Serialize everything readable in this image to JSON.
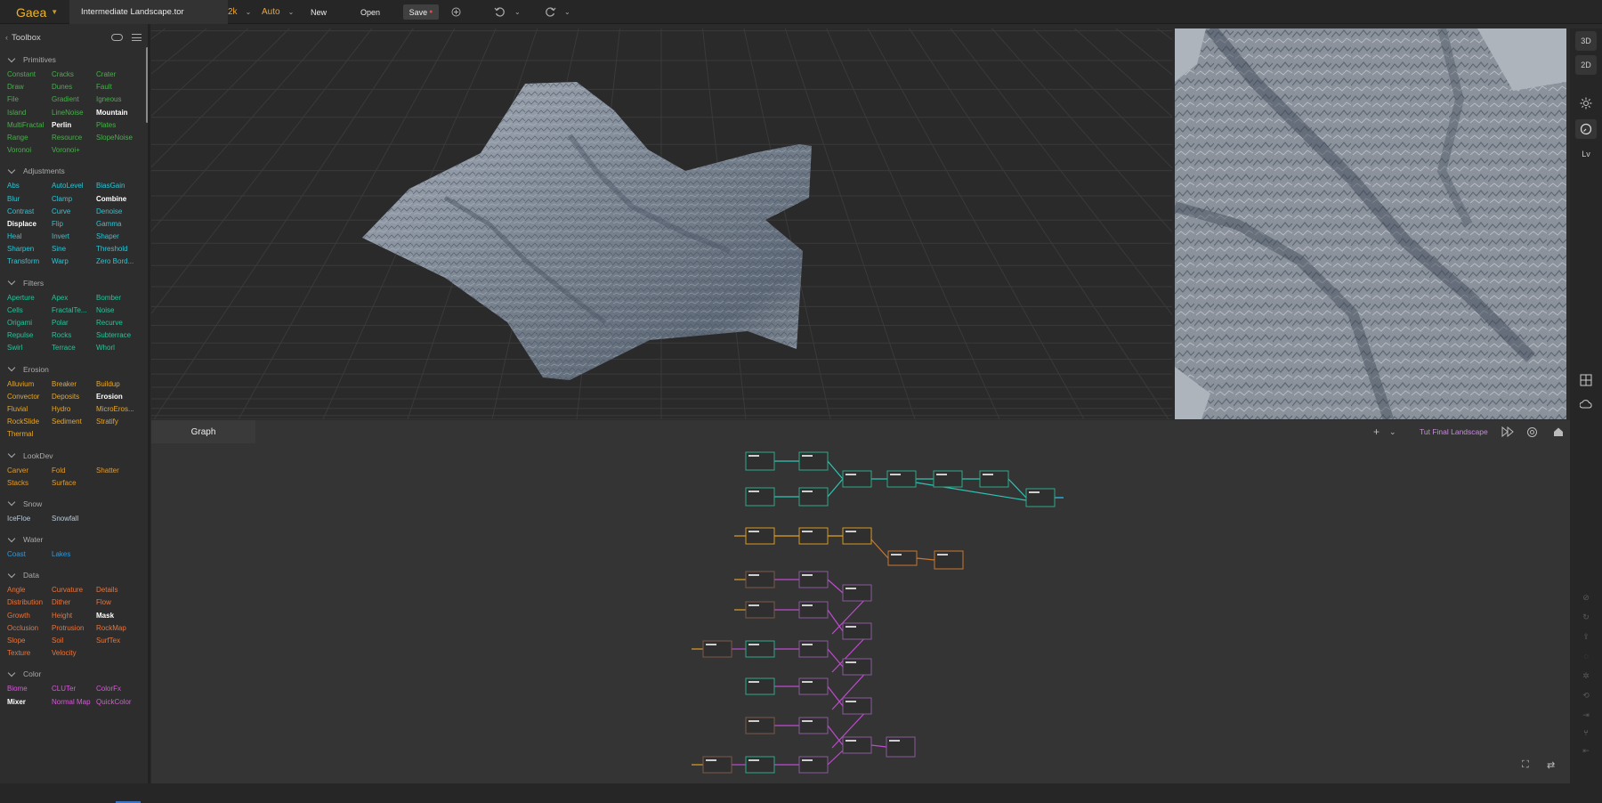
{
  "topbar": {
    "app_name": "Gaea",
    "file_name": "Intermediate Landscape.tor",
    "resolution": "2k",
    "mode": "Auto",
    "new_label": "New",
    "open_label": "Open",
    "save_label": "Save",
    "save_dot": "●",
    "icons": [
      "publish-icon",
      "undo-icon",
      "redo-icon"
    ]
  },
  "toolbox": {
    "title": "Toolbox",
    "back": "‹",
    "categories": [
      {
        "name": "Primitives",
        "color": "#47b04a",
        "nodes": [
          "Constant",
          "Cracks",
          "Crater",
          "Draw",
          "Dunes",
          "Fault",
          "File",
          "Gradient",
          "Igneous",
          "Island",
          "LineNoise",
          "Mountain",
          "MultiFractal",
          "Perlin",
          "Plates",
          "Range",
          "Resource",
          "SlopeNoise",
          "Voronoi",
          "Voronoi+"
        ],
        "bold": [
          "Mountain",
          "Perlin"
        ]
      },
      {
        "name": "Adjustments",
        "color": "#2fc4d4",
        "nodes": [
          "Abs",
          "AutoLevel",
          "BiasGain",
          "Blur",
          "Clamp",
          "Combine",
          "Contrast",
          "Curve",
          "Denoise",
          "Displace",
          "Flip",
          "Gamma",
          "Heal",
          "Invert",
          "Shaper",
          "Sharpen",
          "Sine",
          "Threshold",
          "Transform",
          "Warp",
          "Zero Bord..."
        ],
        "bold": [
          "Combine",
          "Displace"
        ]
      },
      {
        "name": "Filters",
        "color": "#27c49a",
        "nodes": [
          "Aperture",
          "Apex",
          "Bomber",
          "Cells",
          "FractalTe...",
          "Noise",
          "Origami",
          "Polar",
          "Recurve",
          "Repulse",
          "Rocks",
          "Subterrace",
          "Swirl",
          "Terrace",
          "Whorl"
        ],
        "bold": []
      },
      {
        "name": "Erosion",
        "color": "#e7a628",
        "nodes": [
          "Alluvium",
          "Breaker",
          "Buildup",
          "Convector",
          "Deposits",
          "Erosion",
          "Fluvial",
          "Hydro",
          "MicroEros...",
          "RockSlide",
          "Sediment",
          "Stratify",
          "Thermal"
        ],
        "bold": [
          "Erosion"
        ]
      },
      {
        "name": "LookDev",
        "color": "#e29a2c",
        "nodes": [
          "Carver",
          "Fold",
          "Shatter",
          "Stacks",
          "Surface"
        ],
        "bold": []
      },
      {
        "name": "Snow",
        "color": "#b9c9d9",
        "nodes": [
          "IceFloe",
          "Snowfall"
        ],
        "bold": []
      },
      {
        "name": "Water",
        "color": "#2f98dc",
        "nodes": [
          "Coast",
          "Lakes"
        ],
        "bold": []
      },
      {
        "name": "Data",
        "color": "#e8743c",
        "nodes": [
          "Angle",
          "Curvature",
          "Details",
          "Distribution",
          "Dither",
          "Flow",
          "Growth",
          "Height",
          "Mask",
          "Occlusion",
          "Protrusion",
          "RockMap",
          "Slope",
          "Soil",
          "SurfTex",
          "Texture",
          "Velocity"
        ],
        "bold": [
          "Mask"
        ]
      },
      {
        "name": "Color",
        "color": "#d65ad6",
        "nodes": [
          "Biome",
          "CLUTer",
          "ColorFx",
          "Mixer",
          "Normal Map",
          "QuickColor"
        ],
        "bold": [
          "Mixer"
        ]
      }
    ]
  },
  "right_tools": {
    "view_3d": "3D",
    "view_2d": "2D",
    "lv": "Lv"
  },
  "graph": {
    "tab": "Graph",
    "title": "Tut Final Landscape",
    "add": "+",
    "chev": "⌄"
  }
}
